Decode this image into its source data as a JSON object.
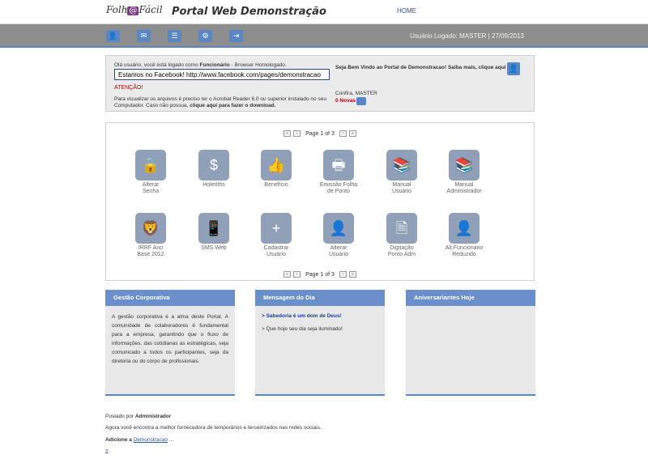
{
  "header": {
    "logo_left": "Folh",
    "logo_at": "@",
    "logo_right": "Fácil",
    "title": "Portal Web Demonstração",
    "home_link": "HOME"
  },
  "toolbar": {
    "buttons": [
      {
        "icon": "user-icon",
        "glyph": "👤"
      },
      {
        "icon": "mail-icon",
        "glyph": "✉"
      },
      {
        "icon": "list-icon",
        "glyph": "☰"
      },
      {
        "icon": "gear-icon",
        "glyph": "⚙"
      },
      {
        "icon": "logout-icon",
        "glyph": "⇥"
      }
    ],
    "user_info": "Usuário Logado: MASTER | 27/09/2013"
  },
  "welcome": {
    "greeting_prefix": "Olá usuário, você está logado como ",
    "greeting_role": "Funcionário",
    "greeting_suffix": " - Browser Homologado.",
    "facebook_text": "Estamos no Facebook! http://www.facebook.com/pages/demonstracao",
    "atencao": "ATENÇÃO!",
    "acrobat_text": "Para visualizar os arquivos é preciso ter o Acrobat Reader 6.0 ou superior instalado no seu Computador. Caso não possua, ",
    "acrobat_link": "clique aqui para fazer o download.",
    "portal_welcome": "Seja Bem Vindo ao Portal de Demonstracao! Saiba mais, clique aqui ->",
    "confira": "Confira, MASTER",
    "novas": "0 Novas"
  },
  "pager": {
    "text": "Page 1 of 3",
    "first": "«",
    "prev": "‹",
    "next": "›",
    "last": "»"
  },
  "apps": [
    {
      "icon": "lock-icon",
      "glyph": "🔒",
      "line1": "Alterar",
      "line2": "Senha"
    },
    {
      "icon": "payslip-icon",
      "glyph": "$",
      "line1": "Holeriths",
      "line2": ""
    },
    {
      "icon": "thumbs-up-icon",
      "glyph": "👍",
      "line1": "Benefício",
      "line2": ""
    },
    {
      "icon": "printer-icon",
      "glyph": "🖶",
      "line1": "Emissão Folha",
      "line2": "de Ponto"
    },
    {
      "icon": "books-icon",
      "glyph": "📚",
      "line1": "Manual",
      "line2": "Usuário"
    },
    {
      "icon": "books-icon",
      "glyph": "📚",
      "line1": "Manual",
      "line2": "Administrador"
    },
    {
      "icon": "lion-icon",
      "glyph": "🦁",
      "line1": "IRRF Ano",
      "line2": "Base 2012"
    },
    {
      "icon": "phone-icon",
      "glyph": "📱",
      "line1": "SMS Web",
      "line2": ""
    },
    {
      "icon": "add-user-icon",
      "glyph": "+",
      "line1": "Cadastrar",
      "line2": "Usuário"
    },
    {
      "icon": "edit-user-icon",
      "glyph": "👤",
      "line1": "Alterar",
      "line2": "Usuário"
    },
    {
      "icon": "document-icon",
      "glyph": "🗎",
      "line1": "Digitação",
      "line2": "Ponto Adm"
    },
    {
      "icon": "user-settings-icon",
      "glyph": "👤",
      "line1": "Alt.Funcionário",
      "line2": "Reduzido"
    }
  ],
  "panels": {
    "gestao": {
      "title": "Gestão Corporativa",
      "body": "A gestão corporativa é a alma deste Portal. A comunidade de colaboradores é fundamental para a empresa, garantindo que o fluxo de informações, das cotidianas as estratégicas, seja comunicado a todos os participantes, seja da diretoria ou do corpo de profissionais."
    },
    "mensagem": {
      "title": "Mensagem do Dia",
      "line1": "> Sabedoria é um dom de Deus!",
      "line2": "> Que hoje seu dia seja iluminado!"
    },
    "aniversariantes": {
      "title": "Aniversariantes Hoje"
    }
  },
  "footer": {
    "postado_prefix": "Postado por ",
    "postado_author": "Administrador",
    "fornecedora": "Agora você encontra a melhor fornecedora de temporários e terceirizados nas redes sociais.",
    "adicione_prefix": "Adicione a ",
    "adicione_link": "Demonstracao",
    "adicione_suffix": " ...",
    "extra_link": "»"
  }
}
